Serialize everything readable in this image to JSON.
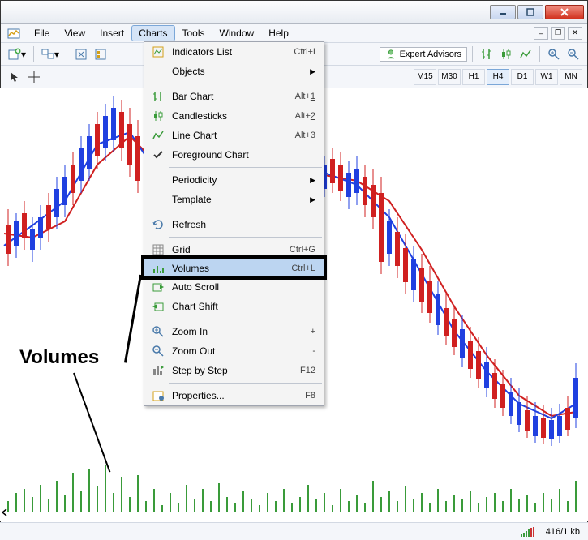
{
  "menubar": {
    "items": [
      "File",
      "View",
      "Insert",
      "Charts",
      "Tools",
      "Window",
      "Help"
    ],
    "active_index": 3
  },
  "toolbar2": {
    "expert_advisors": "Expert Advisors"
  },
  "timeframes": [
    "M15",
    "M30",
    "H1",
    "H4",
    "D1",
    "W1",
    "MN"
  ],
  "timeframe_active": "H4",
  "dropdown": {
    "groups": [
      [
        {
          "icon": "indicators",
          "label": "Indicators List",
          "shortcut": "Ctrl+I"
        },
        {
          "icon": "objects",
          "label": "Objects",
          "arrow": true
        }
      ],
      [
        {
          "icon": "bar",
          "label": "Bar Chart",
          "shortcut": "Alt+1",
          "underline": "1"
        },
        {
          "icon": "candle",
          "label": "Candlesticks",
          "shortcut": "Alt+2",
          "underline": "2"
        },
        {
          "icon": "line",
          "label": "Line Chart",
          "shortcut": "Alt+3",
          "underline": "3"
        },
        {
          "icon": "check",
          "label": "Foreground Chart"
        }
      ],
      [
        {
          "icon": "",
          "label": "Periodicity",
          "arrow": true
        },
        {
          "icon": "",
          "label": "Template",
          "arrow": true
        }
      ],
      [
        {
          "icon": "refresh",
          "label": "Refresh"
        }
      ],
      [
        {
          "icon": "grid",
          "label": "Grid",
          "shortcut": "Ctrl+G"
        },
        {
          "icon": "volumes",
          "label": "Volumes",
          "shortcut": "Ctrl+L",
          "highlighted": true
        },
        {
          "icon": "autoscroll",
          "label": "Auto Scroll"
        },
        {
          "icon": "chartshift",
          "label": "Chart Shift"
        }
      ],
      [
        {
          "icon": "zoomin",
          "label": "Zoom In",
          "shortcut": "+"
        },
        {
          "icon": "zoomout",
          "label": "Zoom Out",
          "shortcut": "-"
        },
        {
          "icon": "step",
          "label": "Step by Step",
          "shortcut": "F12"
        }
      ],
      [
        {
          "icon": "props",
          "label": "Properties...",
          "shortcut": "F8"
        }
      ]
    ]
  },
  "annotation": {
    "label": "Volumes"
  },
  "statusbar": {
    "kb": "416/1 kb"
  },
  "chart_data": {
    "type": "candlestick",
    "note": "approximate OHLC values read visually from pixel positions; y-axis unlabeled in crop",
    "overlays": [
      "MA-red",
      "MA-blue"
    ],
    "candles_approx_count": 75,
    "volume_bars_visible": true
  }
}
